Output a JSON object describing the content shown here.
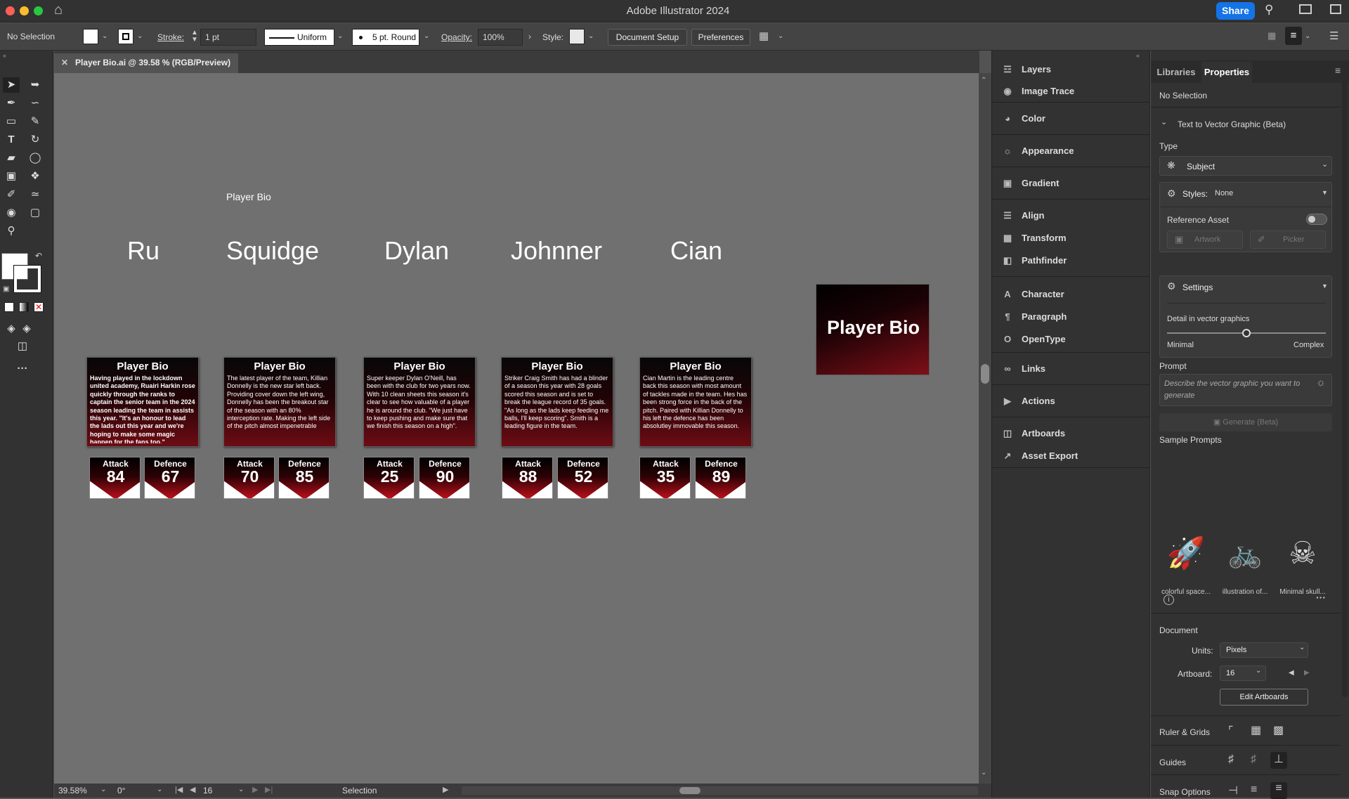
{
  "app": {
    "title": "Adobe Illustrator 2024",
    "share_label": "Share"
  },
  "control_bar": {
    "selection": "No Selection",
    "stroke_label": "Stroke:",
    "stroke_value": "1 pt",
    "profile": "Uniform",
    "brush": "5 pt. Round",
    "opacity_label": "Opacity:",
    "opacity_value": "100%",
    "style_label": "Style:",
    "document_setup": "Document Setup",
    "preferences": "Preferences"
  },
  "document_tab": {
    "title": "Player Bio.ai @ 39.58 % (RGB/Preview)"
  },
  "canvas": {
    "label": "Player Bio",
    "players": [
      {
        "name": "Ru",
        "heading": "Player Bio",
        "bio": "Having played in the lockdown united academy, Ruairi Harkin rose quickly through the ranks to captain the senior team in the 2024 season leading the team in assists this year. \"It's an honour to lead the lads out this year and we're hoping to make some magic happen for the fans too.\"",
        "attack_label": "Attack",
        "attack": "84",
        "defence_label": "Defence",
        "defence": "67"
      },
      {
        "name": "Squidge",
        "heading": "Player Bio",
        "bio": "The latest player of the team, Killian Donnelly is the new star left back. Providing cover down the left wing, Donnelly has been the breakout star of the season with an 80% interception rate. Making the left side of the pitch almost impenetrable",
        "attack_label": "Attack",
        "attack": "70",
        "defence_label": "Defence",
        "defence": "85"
      },
      {
        "name": "Dylan",
        "heading": "Player Bio",
        "bio": "Super keeper Dylan O'Neill, has been with the club for two years now. With 10 clean sheets this season it's clear to see how valuable of a player he is around the club. \"We just have to keep pushing and make sure that we finish this season on a high\".",
        "attack_label": "Attack",
        "attack": "25",
        "defence_label": "Defence",
        "defence": "90"
      },
      {
        "name": "Johnner",
        "heading": "Player Bio",
        "bio": "Striker Craig Smith has had a blinder of a season this year with 28 goals scored this season and is set to break the league record of 35 goals. \"As long as the lads keep feeding me balls, I'll keep scoring\". Smith is a leading figure in the team.",
        "attack_label": "Attack",
        "attack": "88",
        "defence_label": "Defence",
        "defence": "52"
      },
      {
        "name": "Cian",
        "heading": "Player Bio",
        "bio": "Cian Martin is the leading centre back this season with most amount of tackles made in the team. Hes has been strong force in the back of the pitch. Paired with Killian Donnelly to his left the defence has been absolutley immovable this season.",
        "attack_label": "Attack",
        "attack": "35",
        "defence_label": "Defence",
        "defence": "89"
      }
    ],
    "title_card": "Player Bio"
  },
  "status_bar": {
    "zoom": "39.58%",
    "rotation": "0°",
    "artboard": "16",
    "tool": "Selection"
  },
  "panels": {
    "items": [
      "Layers",
      "Image Trace",
      "Color",
      "Appearance",
      "Gradient",
      "Align",
      "Transform",
      "Pathfinder",
      "Character",
      "Paragraph",
      "OpenType",
      "Links",
      "Actions",
      "Artboards",
      "Asset Export"
    ]
  },
  "properties": {
    "tabs": [
      "Libraries",
      "Properties"
    ],
    "selection": "No Selection",
    "ttv_title": "Text to Vector Graphic (Beta)",
    "type_label": "Type",
    "type_value": "Subject",
    "styles_label": "Styles:",
    "styles_value": "None",
    "reference_asset": "Reference Asset",
    "artwork": "Artwork",
    "picker": "Picker",
    "settings": "Settings",
    "detail_label": "Detail in vector graphics",
    "detail_min": "Minimal",
    "detail_max": "Complex",
    "detail_level": 0.5,
    "prompt_label": "Prompt",
    "prompt_placeholder": "Describe the vector graphic you want to generate",
    "generate": "Generate (Beta)",
    "sample_prompts": "Sample Prompts",
    "samples": [
      "colorful space...",
      "illustration of...",
      "Minimal skull..."
    ],
    "document": "Document",
    "units_label": "Units:",
    "units_value": "Pixels",
    "artboard_label": "Artboard:",
    "artboard_value": "16",
    "edit_artboards": "Edit Artboards",
    "ruler_grids": "Ruler & Grids",
    "guides": "Guides",
    "snap_options": "Snap Options"
  },
  "colors": {
    "accent": "#1473e6",
    "card_red": "#c4101c"
  }
}
